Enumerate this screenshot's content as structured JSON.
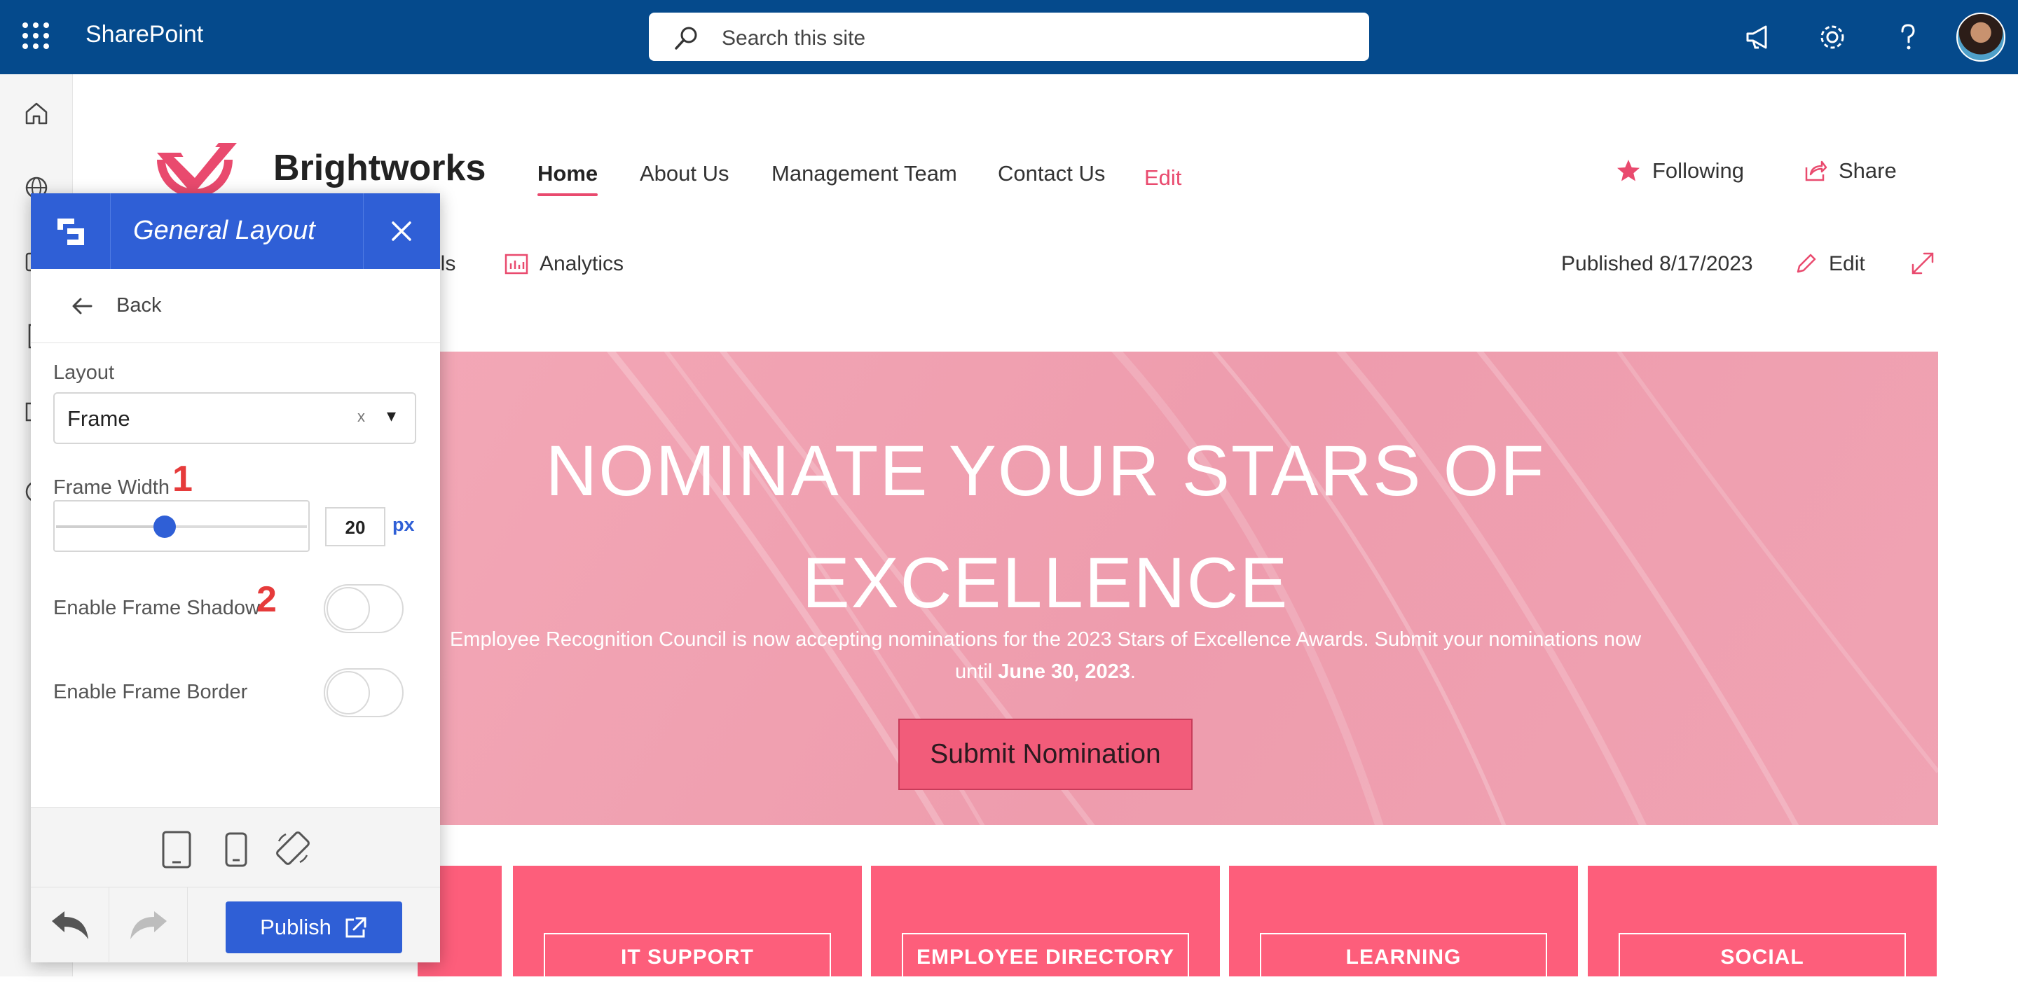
{
  "suite": {
    "brand": "SharePoint",
    "search_placeholder": "Search this site",
    "icons": [
      "waffle-icon",
      "megaphone-icon",
      "gear-icon",
      "help-icon",
      "avatar"
    ]
  },
  "rail": {
    "icons": [
      "home-icon",
      "globe-icon",
      "news-icon",
      "files-icon",
      "lists-icon",
      "create-icon"
    ]
  },
  "site": {
    "title": "Brightworks",
    "nav": [
      {
        "label": "Home",
        "active": true
      },
      {
        "label": "About Us"
      },
      {
        "label": "Management Team"
      },
      {
        "label": "Contact Us"
      },
      {
        "label": "Edit"
      }
    ],
    "following_label": "Following",
    "share_label": "Share"
  },
  "command_bar": {
    "details_fragment": "ils",
    "analytics_label": "Analytics",
    "published_label": "Published 8/17/2023",
    "edit_label": "Edit"
  },
  "hero": {
    "title_line1": "NOMINATE YOUR STARS OF",
    "title_line2": "EXCELLENCE",
    "subtitle_line1": "Employee Recognition Council is now accepting nominations for the 2023 Stars of Excellence Awards. Submit your nominations now",
    "subtitle_until": "until ",
    "subtitle_date": "June 30, 2023",
    "subtitle_end": ".",
    "button_label": "Submit Nomination"
  },
  "tiles": [
    "IT SUPPORT",
    "EMPLOYEE DIRECTORY",
    "LEARNING",
    "SOCIAL"
  ],
  "panel": {
    "title": "General Layout",
    "back_label": "Back",
    "layout_label": "Layout",
    "layout_value": "Frame",
    "frame_width_label": "Frame Width",
    "frame_width_value": "20",
    "frame_width_fraction": 0.42,
    "unit": "px",
    "shadow_label": "Enable Frame Shadow",
    "shadow_enabled": false,
    "border_label": "Enable Frame Border",
    "border_enabled": false,
    "marker_1": "1",
    "marker_2": "2",
    "publish_label": "Publish",
    "clear_symbol": "x",
    "dropdown_symbol": "▾"
  },
  "colors": {
    "suite_bar": "#054a8c",
    "accent_pink": "#e94a6e",
    "tile_pink": "#fd5e7b",
    "panel_blue": "#2f5fd6",
    "marker_red": "#e63b3b"
  }
}
